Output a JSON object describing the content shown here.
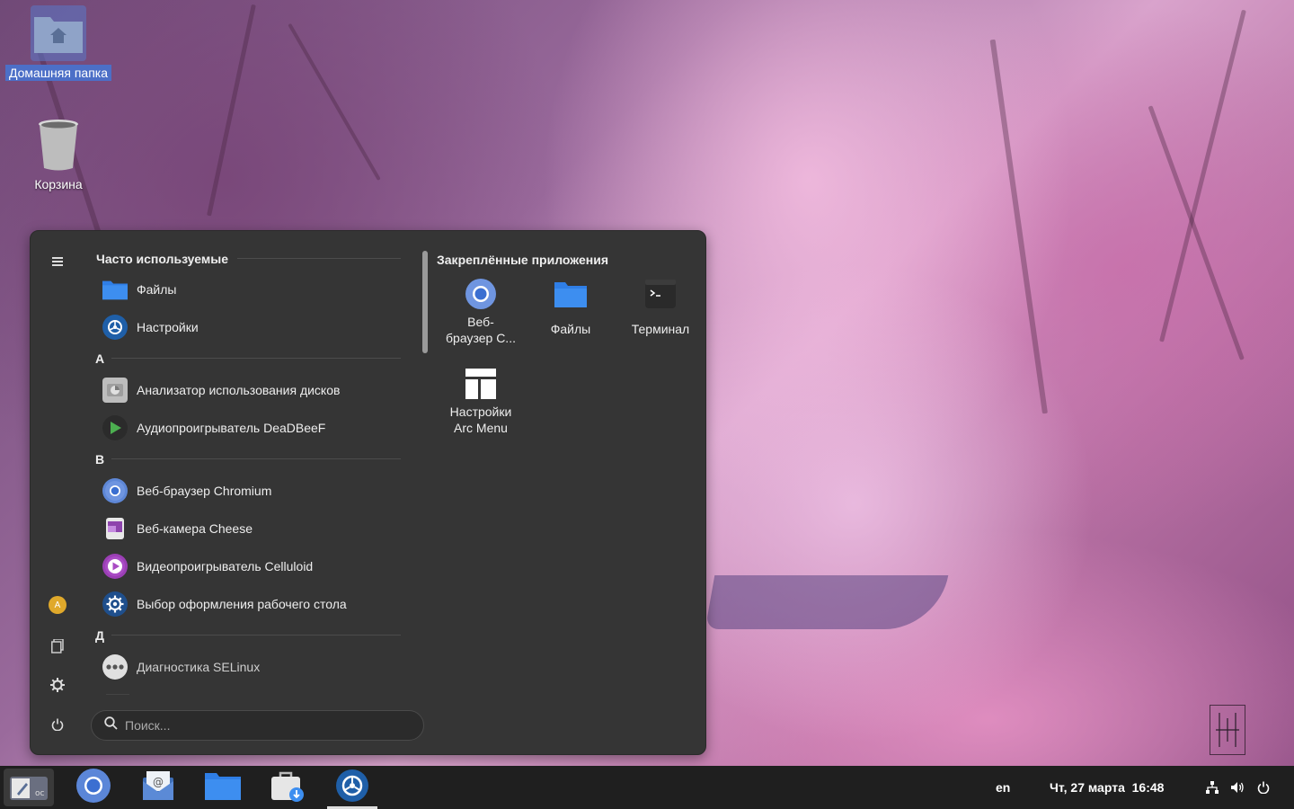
{
  "desktop": {
    "home_label": "Домашняя папка",
    "trash_label": "Корзина"
  },
  "menu": {
    "frequent_title": "Часто используемые",
    "frequent": [
      {
        "label": "Файлы",
        "icon": "folder-icon"
      },
      {
        "label": "Настройки",
        "icon": "settings-icon"
      }
    ],
    "groups": [
      {
        "letter": "А",
        "apps": [
          {
            "label": "Анализатор использования дисков",
            "icon": "disk-usage-icon"
          },
          {
            "label": "Аудиопроигрыватель DeaDBeeF",
            "icon": "deadbeef-icon"
          }
        ]
      },
      {
        "letter": "В",
        "apps": [
          {
            "label": "Веб-браузер Chromium",
            "icon": "chromium-icon"
          },
          {
            "label": "Веб-камера Cheese",
            "icon": "cheese-icon"
          },
          {
            "label": "Видеопроигрыватель Celluloid",
            "icon": "celluloid-icon"
          },
          {
            "label": "Выбор оформления рабочего стола",
            "icon": "theme-icon"
          }
        ]
      },
      {
        "letter": "Д",
        "apps": [
          {
            "label": "Диагностика SELinux",
            "icon": "selinux-icon"
          }
        ]
      }
    ],
    "pinned_title": "Закреплённые приложения",
    "pinned": [
      {
        "label_line1": "Веб-",
        "label_line2": "браузер C...",
        "icon": "chromium-icon"
      },
      {
        "label_line1": "Файлы",
        "label_line2": "",
        "icon": "folder-icon"
      },
      {
        "label_line1": "Терминал",
        "label_line2": "",
        "icon": "terminal-icon"
      },
      {
        "label_line1": "Настройки",
        "label_line2": "Arc Menu",
        "icon": "arc-menu-settings-icon"
      }
    ],
    "search_placeholder": "Поиск..."
  },
  "taskbar": {
    "keyboard_layout": "en",
    "datetime": "Чт, 27 марта  16:48"
  },
  "colors": {
    "menu_bg": "#353535",
    "taskbar_bg": "#1f1f1f",
    "accent_blue": "#3d8ef0"
  }
}
